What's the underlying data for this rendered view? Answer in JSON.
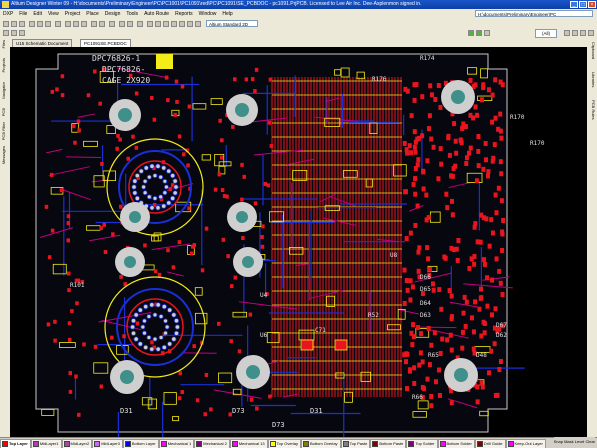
{
  "window": {
    "title": "Altium Designer Winter 09 - H:\\documents\\Preliminary\\Engineer\\PC\\PC1001\\PC1091\\red\\PC\\PC1091\\SE_PCBDOC - pc1091.PrjPCB. Licensed to Lee Air Inc. Dee-Asplenmon signed in.",
    "buttons": [
      "_",
      "□",
      "×"
    ]
  },
  "menu": {
    "items": [
      "DXP",
      "File",
      "Edit",
      "View",
      "Project",
      "Place",
      "Design",
      "Tools",
      "Auto Route",
      "Reports",
      "Window",
      "Help"
    ],
    "path_box": "H:\\documents\\Preliminary\\Engineer\\PC"
  },
  "toolbar": {
    "standard_combo": "Altium Standard 2D",
    "nav_value": "(All)"
  },
  "left_panels": [
    "Files",
    "Projects",
    "Navigator",
    "PCB",
    "PCB Filter",
    "Messages"
  ],
  "right_panels": [
    "Clipboard",
    "Libraries",
    "PCB Rules"
  ],
  "tabs": [
    {
      "label": "U15 Schematic Document",
      "active": false
    },
    {
      "label": "PC1091SE.PCBDOC",
      "active": true
    }
  ],
  "board": {
    "silk_lines": [
      "DPC76826-1",
      "DPC76826-",
      "CAGE 2X920"
    ],
    "designators": [
      "R174",
      "R176",
      "R170",
      "R52",
      "R65",
      "R66",
      "D31",
      "D73",
      "D64",
      "D65",
      "D66",
      "D67",
      "D48",
      "D62",
      "D63",
      "C71",
      "U4",
      "U6",
      "U8",
      "R101",
      "R170",
      "D31",
      "D73"
    ],
    "colors": {
      "top_copper": "#e8141e",
      "bottom_copper": "#1a2fd6",
      "top_overlay": "#f4ec19",
      "mid_layer": "#c20080",
      "board_outline": "#c8c8c8",
      "background": "#000000"
    }
  },
  "layers": [
    {
      "name": "Top Layer",
      "color": "#ff0000",
      "active": true
    },
    {
      "name": "MidLayer1",
      "color": "#b33cb3",
      "active": false
    },
    {
      "name": "MidLayer2",
      "color": "#ab47ab",
      "active": false
    },
    {
      "name": "MidLayer3",
      "color": "#cc66ff",
      "active": false
    },
    {
      "name": "Bottom Layer",
      "color": "#0000ff",
      "active": false
    },
    {
      "name": "Mechanical 1",
      "color": "#ff00ff",
      "active": false
    },
    {
      "name": "Mechanical 2",
      "color": "#800080",
      "active": false
    },
    {
      "name": "Mechanical 13",
      "color": "#ff00ff",
      "active": false
    },
    {
      "name": "Top Overlay",
      "color": "#ffff00",
      "active": false
    },
    {
      "name": "Bottom Overlay",
      "color": "#808000",
      "active": false
    },
    {
      "name": "Top Paste",
      "color": "#808080",
      "active": false
    },
    {
      "name": "Bottom Paste",
      "color": "#800000",
      "active": false
    },
    {
      "name": "Top Solder",
      "color": "#800080",
      "active": false
    },
    {
      "name": "Bottom Solder",
      "color": "#ff00ff",
      "active": false
    },
    {
      "name": "Drill Guide",
      "color": "#800000",
      "active": false
    },
    {
      "name": "Keep-Out Layer",
      "color": "#ff00ff",
      "active": false
    }
  ],
  "status": {
    "snap": "Snap",
    "mask": "Mask Level",
    "clear": "Clear"
  }
}
